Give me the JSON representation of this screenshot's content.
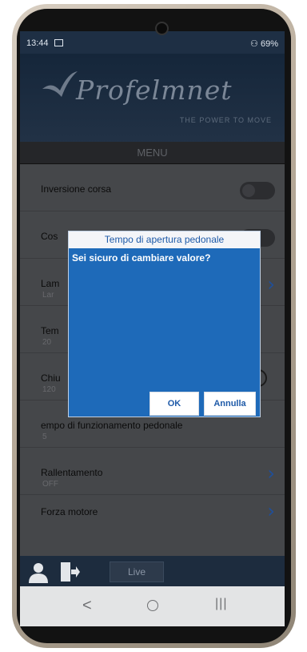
{
  "status": {
    "time": "13:44",
    "battery": "69%"
  },
  "brand": {
    "name": "Profelmnet",
    "tagline": "THE POWER TO MOVE"
  },
  "menu": {
    "title": "MENU"
  },
  "rows": [
    {
      "title": "Inversione corsa",
      "sub": "",
      "control": "toggle"
    },
    {
      "title": "Cos",
      "sub": "",
      "control": "toggle"
    },
    {
      "title": "Lam",
      "sub": "Lar",
      "control": "chevron"
    },
    {
      "title": "Tem",
      "sub": "20",
      "control": "none"
    },
    {
      "title": "Chiu",
      "sub": "120",
      "control": "radio"
    },
    {
      "title": "empo di funzionamento pedonale",
      "sub": "5",
      "control": "none"
    },
    {
      "title": "Rallentamento",
      "sub": "OFF",
      "control": "chevron"
    },
    {
      "title": "Forza motore",
      "sub": "",
      "control": "chevron"
    }
  ],
  "bottombar": {
    "live_label": "Live"
  },
  "dialog": {
    "title": "Tempo di apertura pedonale",
    "message": "Sei sicuro di cambiare valore?",
    "ok_label": "OK",
    "cancel_label": "Annulla"
  },
  "nav": {
    "back": "<",
    "recent": "|||"
  },
  "colors": {
    "header": "#15263a",
    "dialog": "#1e6ab9",
    "accent": "#1f4f9a"
  }
}
